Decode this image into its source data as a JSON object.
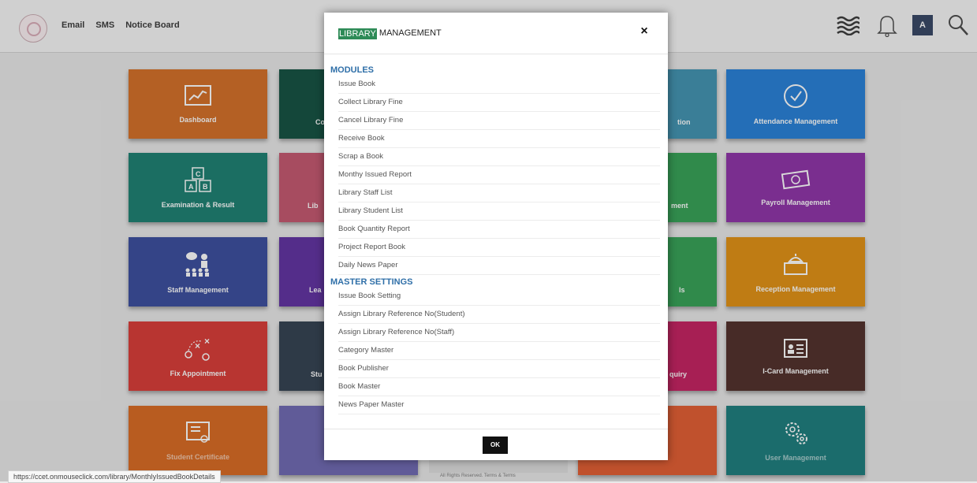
{
  "topnav": {
    "email": "Email",
    "sms": "SMS",
    "notice_board": "Notice Board"
  },
  "header_icons": {
    "menu": "waves-icon",
    "notifications": "bell-icon",
    "avatar_letter": "A",
    "search": "search-icon"
  },
  "tiles": {
    "dashboard": {
      "label": "Dashboard",
      "color": "#d2691e"
    },
    "attendance": {
      "label": "Attendance Management",
      "color": "#1e7bd6"
    },
    "examination": {
      "label": "Examination & Result",
      "color": "#137b6c"
    },
    "payroll": {
      "label": "Payroll Management",
      "color": "#8a2ba4"
    },
    "staff": {
      "label": "Staff Management",
      "color": "#33479a"
    },
    "reception": {
      "label": "Reception Management",
      "color": "#e08c0a"
    },
    "appointment": {
      "label": "Fix Appointment",
      "color": "#d7342f"
    },
    "icard": {
      "label": "I-Card Management",
      "color": "#4a2722"
    },
    "col2_row1_partial": "Co",
    "col2_row2_partial": "Lib",
    "col2_row3_partial": "Lea",
    "col2_row4_partial": "Stu",
    "col4_row1_partial": "tion",
    "col4_row2_partial": "ment",
    "col4_row3_partial": "ls",
    "col4_row4_partial": "quiry",
    "row5_col1": "Student Certificate",
    "row5_col5": "User Management"
  },
  "modal": {
    "title_highlight": "LIBRARY",
    "title_rest": " MANAGEMENT",
    "close": "×",
    "modules_heading": "MODULES",
    "modules": [
      "Issue Book",
      "Collect Library Fine",
      "Cancel Library Fine",
      "Receive Book",
      "Scrap a Book",
      "Monthy Issued Report",
      "Library Staff List",
      "Library Student List",
      "Book Quantity Report",
      "Project Report Book",
      "Daily News Paper"
    ],
    "master_heading": "MASTER SETTINGS",
    "master": [
      "Issue Book Setting",
      "Assign Library Reference No(Student)",
      "Assign Library Reference No(Staff)",
      "Category Master",
      "Book Publisher",
      "Book Master",
      "News Paper Master"
    ],
    "ok_label": "OK"
  },
  "status_url": "https://ccet.onmouseclick.com/library/MonthlyIssuedBookDetails",
  "footer_note": "All Rights Reserved. Terms & Terms"
}
